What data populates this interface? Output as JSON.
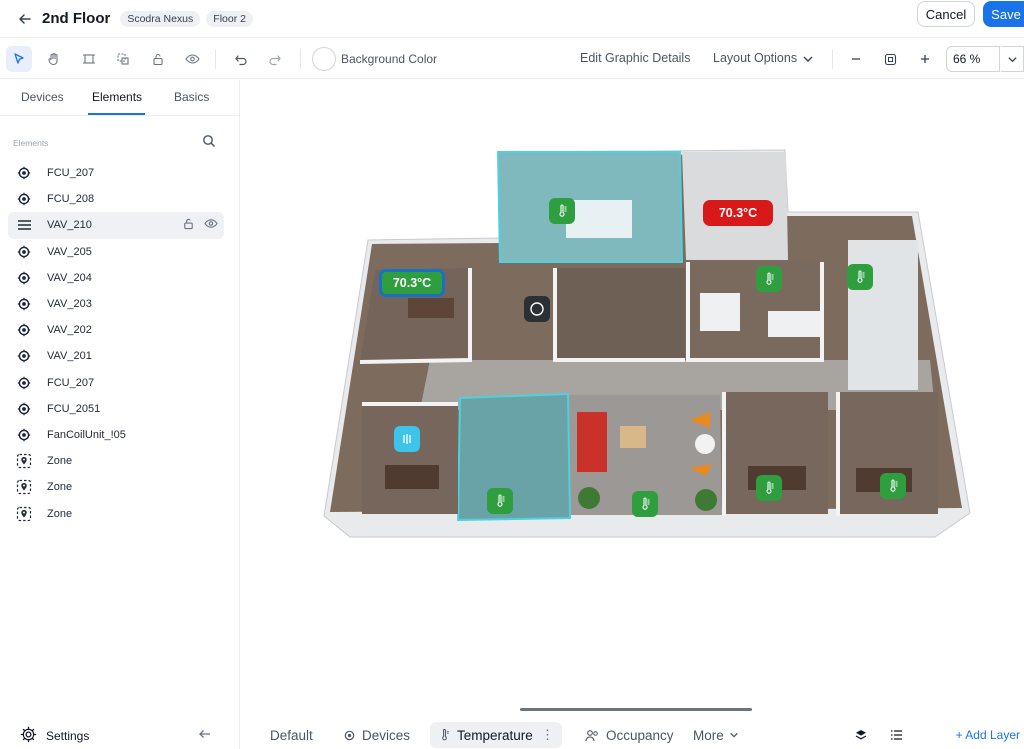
{
  "header": {
    "title": "2nd Floor",
    "chips": [
      "Scodra Nexus",
      "Floor 2"
    ],
    "cancel_label": "Cancel",
    "save_label": "Save"
  },
  "toolbar": {
    "background_color_label": "Background Color",
    "edit_graphic_label": "Edit Graphic Details",
    "layout_options_label": "Layout Options",
    "zoom_value": "66 %"
  },
  "sidebar": {
    "tabs": [
      "Devices",
      "Elements",
      "Basics"
    ],
    "active_tab": "Elements",
    "section_label": "Elements",
    "items": [
      {
        "label": "FCU_207",
        "icon": "device-chip-icon"
      },
      {
        "label": "FCU_208",
        "icon": "device-chip-icon"
      },
      {
        "label": "VAV_210",
        "icon": "drag-handle-icon"
      },
      {
        "label": "VAV_205",
        "icon": "device-chip-icon"
      },
      {
        "label": "VAV_204",
        "icon": "device-chip-icon"
      },
      {
        "label": "VAV_203",
        "icon": "device-chip-icon"
      },
      {
        "label": "VAV_202",
        "icon": "device-chip-icon"
      },
      {
        "label": "VAV_201",
        "icon": "device-chip-icon"
      },
      {
        "label": "FCU_207",
        "icon": "device-chip-icon"
      },
      {
        "label": "FCU_2051",
        "icon": "device-chip-icon"
      },
      {
        "label": "FanCoilUnit_!05",
        "icon": "device-chip-icon"
      },
      {
        "label": "Zone",
        "icon": "zone-icon"
      },
      {
        "label": "Zone",
        "icon": "zone-icon"
      },
      {
        "label": "Zone",
        "icon": "zone-icon"
      }
    ],
    "settings_label": "Settings"
  },
  "canvas": {
    "temp_badge_1": "70.3°C",
    "temp_badge_2": "70.3°C",
    "colors": {
      "hot": "#d7191a",
      "ok": "#2e9e3f",
      "zone_highlight": "#8edfe6",
      "accent": "#1a73e8"
    }
  },
  "bottom_tabs": {
    "default": "Default",
    "devices": "Devices",
    "temperature": "Temperature",
    "occupancy": "Occupancy",
    "more": "More",
    "add_layer": "+ Add Layer"
  }
}
